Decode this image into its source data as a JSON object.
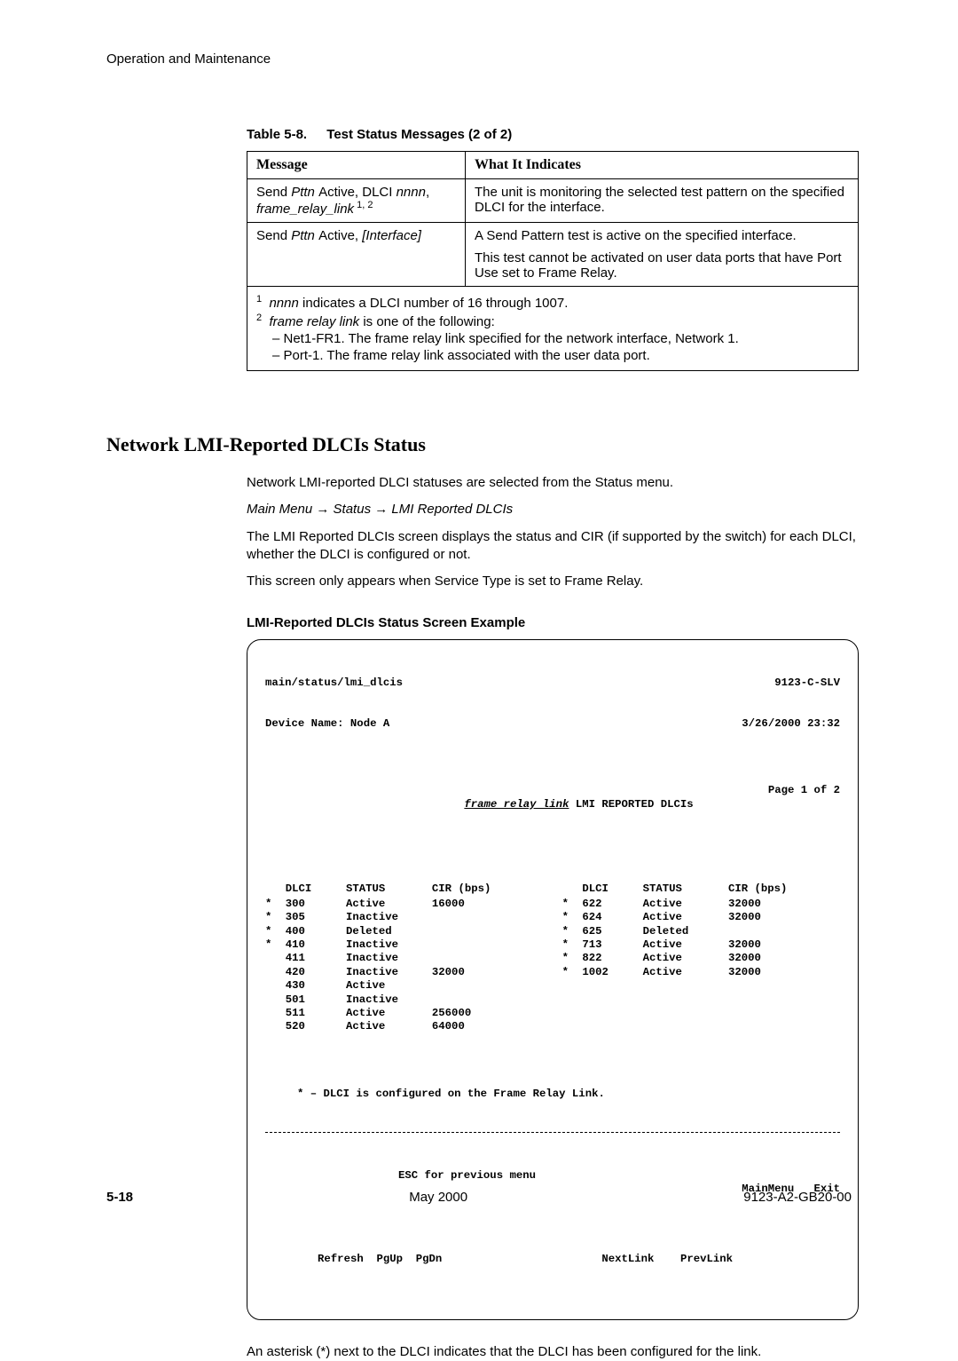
{
  "header": {
    "title": "Operation and Maintenance"
  },
  "table": {
    "caption_label": "Table 5-8.",
    "caption_title": "Test Status Messages (2 of 2)",
    "col1": "Message",
    "col2": "What It Indicates",
    "rows": [
      {
        "msg_pre": "Send ",
        "msg_i1": "Pttn ",
        "msg_mid": "Active, DLCI ",
        "msg_i2": "nnnn",
        "msg_suf": ",",
        "msg_line2_i": "frame_relay_link",
        "msg_sup": " 1, 2",
        "ind": "The unit is monitoring the selected test pattern on the specified DLCI for the interface."
      },
      {
        "msg_pre": "Send ",
        "msg_i1": "Pttn ",
        "msg_mid": "Active, ",
        "msg_i2": "[Interface]",
        "ind1": "A Send Pattern test is active on the specified interface.",
        "ind2": "This test cannot be activated on user data ports that have Port Use set to Frame Relay."
      }
    ],
    "fn1_sup": "1",
    "fn1_i": "nnnn ",
    "fn1_txt": "indicates a DLCI number of 16 through 1007.",
    "fn2_sup": "2",
    "fn2_i": "frame relay link ",
    "fn2_txt": "is one of the following:",
    "fn_sub1": "– Net1-FR1. The frame relay link specified for the network interface, Network 1.",
    "fn_sub2": "– Port-1. The frame relay link associated with the user data port."
  },
  "section": {
    "heading": "Network LMI-Reported DLCIs Status",
    "p1": "Network LMI-reported DLCI statuses are selected from the Status menu.",
    "nav1": "Main Menu ",
    "nav2": " Status ",
    "nav3": " LMI Reported DLCIs",
    "arrow": "→",
    "p2": "The LMI Reported DLCIs screen displays the status and CIR (if supported by the switch) for each DLCI, whether the DLCI is configured or not.",
    "p3": "This screen only appears when Service Type is set to Frame Relay.",
    "subhead": "LMI-Reported DLCIs Status Screen Example"
  },
  "terminal": {
    "path": "main/status/lmi_dlcis",
    "model": "9123-C-SLV",
    "device_label": "Device Name: Node A",
    "timestamp": "3/26/2000 23:32",
    "title_u": "frame relay link",
    "title_rest": " LMI REPORTED DLCIs",
    "page_info": "Page 1 of 2",
    "hdr_dlci": "DLCI",
    "hdr_status": "STATUS",
    "hdr_cir": "CIR (bps)",
    "left": [
      {
        "m": "*",
        "d": "300",
        "s": "Active",
        "c": "16000"
      },
      {
        "m": "*",
        "d": "305",
        "s": "Inactive",
        "c": ""
      },
      {
        "m": "*",
        "d": "400",
        "s": "Deleted",
        "c": ""
      },
      {
        "m": "*",
        "d": "410",
        "s": "Inactive",
        "c": ""
      },
      {
        "m": "",
        "d": "411",
        "s": "Inactive",
        "c": ""
      },
      {
        "m": "",
        "d": "420",
        "s": "Inactive",
        "c": "32000"
      },
      {
        "m": "",
        "d": "430",
        "s": "Active",
        "c": ""
      },
      {
        "m": "",
        "d": "501",
        "s": "Inactive",
        "c": ""
      },
      {
        "m": "",
        "d": "511",
        "s": "Active",
        "c": "256000"
      },
      {
        "m": "",
        "d": "520",
        "s": "Active",
        "c": "64000"
      }
    ],
    "right": [
      {
        "m": "*",
        "d": "622",
        "s": "Active",
        "c": "32000"
      },
      {
        "m": "*",
        "d": "624",
        "s": "Active",
        "c": "32000"
      },
      {
        "m": "*",
        "d": "625",
        "s": "Deleted",
        "c": ""
      },
      {
        "m": "*",
        "d": "713",
        "s": "Active",
        "c": "32000"
      },
      {
        "m": "*",
        "d": "822",
        "s": "Active",
        "c": "32000"
      },
      {
        "m": "*",
        "d": "1002",
        "s": "Active",
        "c": "32000"
      }
    ],
    "note": "* – DLCI is configured on the Frame Relay Link.",
    "esc": "ESC for previous menu",
    "mainmenu": "MainMenu",
    "exit": "Exit",
    "refresh": "Refresh",
    "pgup": "PgUp",
    "pgdn": "PgDn",
    "nextlink": "NextLink",
    "prevlink": "PrevLink"
  },
  "after_terminal": "An asterisk (*) next to the DLCI indicates that the DLCI has been configured for the link.",
  "footer": {
    "page": "5-18",
    "date": "May 2000",
    "doc": "9123-A2-GB20-00"
  }
}
